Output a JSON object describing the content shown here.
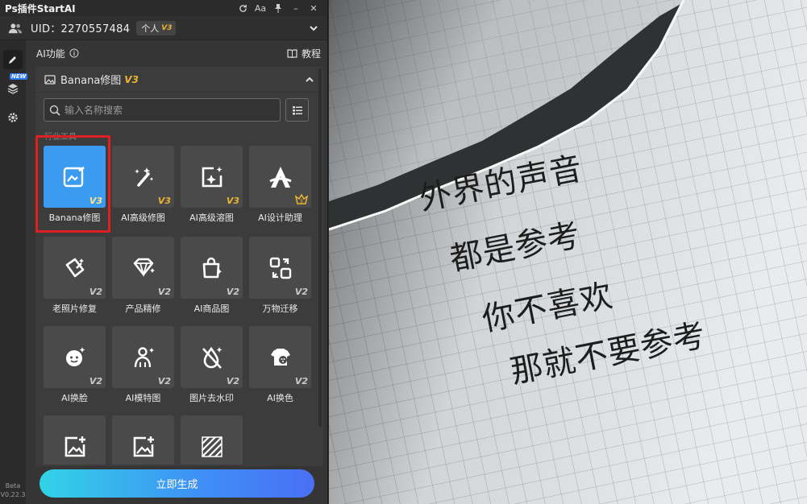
{
  "window": {
    "title": "Ps插件StartAI",
    "buttons": {
      "refresh": "↻",
      "font": "Aa",
      "pin": "📌",
      "minimize": "–",
      "close": "✕"
    }
  },
  "account": {
    "uid": "UID：2270557484",
    "plan": "个人",
    "plan_badge": "V3"
  },
  "rail": {
    "new_badge": "NEW",
    "version_line1": "Beta",
    "version_line2": "V0.22.3"
  },
  "section": {
    "title": "AI功能",
    "tutorial": "教程"
  },
  "panel": {
    "title": "Banana修图",
    "badge": "V3"
  },
  "search": {
    "placeholder": "输入名称搜索"
  },
  "category": "行业工具",
  "tools": [
    {
      "label": "Banana修图",
      "badge": "V3",
      "icon": "image-edit-icon",
      "selected": true
    },
    {
      "label": "AI高级修图",
      "badge": "V3",
      "icon": "magic-wand-icon"
    },
    {
      "label": "AI高级溶图",
      "badge": "V3",
      "icon": "sparkle-frame-icon"
    },
    {
      "label": "AI设计助理",
      "badge": "",
      "icon": "design-assistant-icon"
    },
    {
      "label": "老照片修复",
      "badge": "V2",
      "icon": "photo-repair-icon"
    },
    {
      "label": "产品精修",
      "badge": "V2",
      "icon": "gem-icon"
    },
    {
      "label": "AI商品图",
      "badge": "V2",
      "icon": "shopping-bag-icon"
    },
    {
      "label": "万物迁移",
      "badge": "V2",
      "icon": "transfer-icon"
    },
    {
      "label": "AI换脸",
      "badge": "V2",
      "icon": "face-swap-icon"
    },
    {
      "label": "AI模特图",
      "badge": "V2",
      "icon": "model-icon"
    },
    {
      "label": "图片去水印",
      "badge": "V2",
      "icon": "watermark-remove-icon"
    },
    {
      "label": "AI换色",
      "badge": "V2",
      "icon": "color-swap-icon"
    },
    {
      "label": "",
      "badge": "",
      "icon": "image-plus-icon"
    },
    {
      "label": "",
      "badge": "",
      "icon": "image-plus-icon"
    },
    {
      "label": "",
      "badge": "",
      "icon": "stripes-icon"
    }
  ],
  "generate_button": "立即生成",
  "photo": {
    "lines": [
      "外界的声音",
      "都是参考",
      "你不喜欢",
      "那就不要参考"
    ]
  },
  "colors": {
    "accent": "#3a9bf0",
    "badge_gold": "#e9b52f",
    "highlight_red": "#e02020"
  }
}
